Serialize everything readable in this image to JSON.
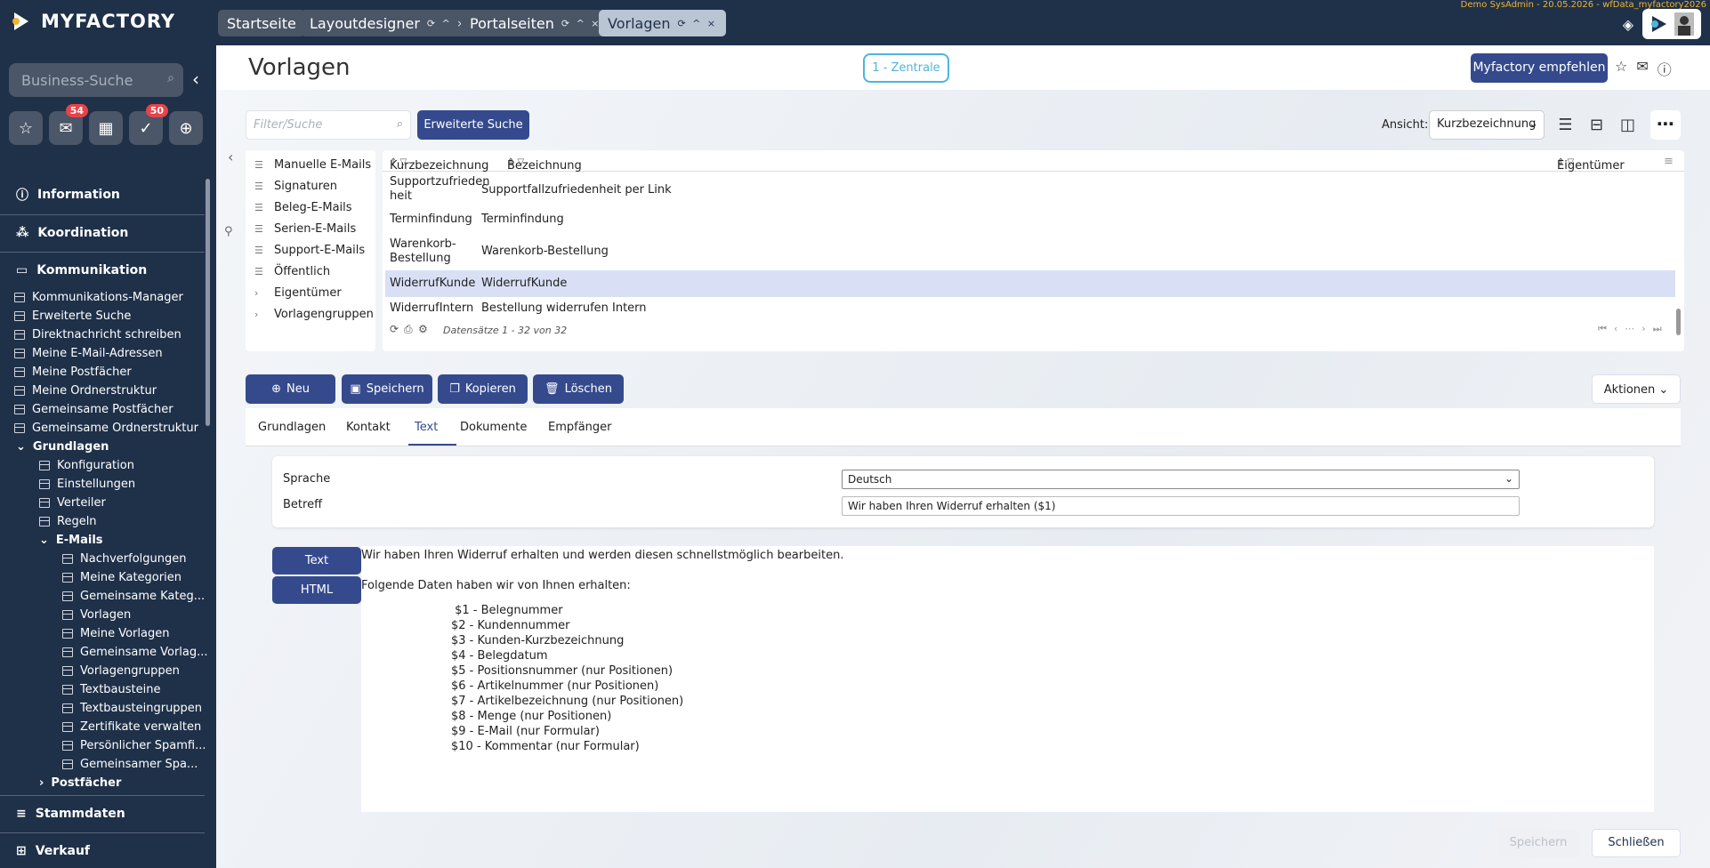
{
  "app": {
    "brand": "MYFACTORY",
    "user_info": "Demo SysAdmin - 20.05.2026 - wfData_myfactory2026"
  },
  "tabs": [
    {
      "label": "Startseite",
      "controls": ""
    },
    {
      "label": "Layoutdesigner",
      "controls": "⟳ ^ ×"
    },
    {
      "label": "Portalseiten",
      "controls": "⟳ ^ ×"
    },
    {
      "label": "Vorlagen",
      "controls": "⟳ ^ ×"
    }
  ],
  "sidebar": {
    "search_placeholder": "Business-Suche",
    "badges": {
      "mail": "54",
      "tasks": "50"
    },
    "sections": {
      "information": "Information",
      "koordination": "Koordination",
      "kommunikation": "Kommunikation",
      "stammdaten": "Stammdaten",
      "verkauf": "Verkauf"
    },
    "comm_items": [
      "Kommunikations-Manager",
      "Erweiterte Suche",
      "Direktnachricht schreiben",
      "Meine E-Mail-Adressen",
      "Meine Postfächer",
      "Meine Ordnerstruktur",
      "Gemeinsame Postfächer",
      "Gemeinsame Ordnerstruktur"
    ],
    "grundlagen": "Grundlagen",
    "grundlagen_items": [
      "Konfiguration",
      "Einstellungen",
      "Verteiler",
      "Regeln"
    ],
    "emails": "E-Mails",
    "email_items": [
      "Nachverfolgungen",
      "Meine Kategorien",
      "Gemeinsame Kateg...",
      "Vorlagen",
      "Meine Vorlagen",
      "Gemeinsame Vorlag...",
      "Vorlagengruppen",
      "Textbausteine",
      "Textbausteingruppen",
      "Zertifikate verwalten",
      "Persönlicher Spamfi...",
      "Gemeinsamer Spa..."
    ],
    "postfaecher": "Postfächer"
  },
  "header": {
    "title": "Vorlagen",
    "location": "1 - Zentrale",
    "recommend": "Myfactory empfehlen"
  },
  "toolbar": {
    "filter_placeholder": "Filter/Suche",
    "advanced_search": "Erweiterte Suche",
    "view_label": "Ansicht:",
    "view_value": "Kurzbezeichnung"
  },
  "tree": [
    "Manuelle E-Mails",
    "Signaturen",
    "Beleg-E-Mails",
    "Serien-E-Mails",
    "Support-E-Mails",
    "Öffentlich",
    "Eigentümer",
    "Vorlagengruppen"
  ],
  "grid": {
    "columns": {
      "c1": "Kurzbezeichnung",
      "c2": "Bezeichnung",
      "c3": "Eigentümer"
    },
    "rows": [
      {
        "kurz": "Supportzufriedenheit",
        "bez": "Supportfallzufriedenheit per Link"
      },
      {
        "kurz": "Terminfindung",
        "bez": "Terminfindung"
      },
      {
        "kurz": "Warenkorb-Bestellung",
        "bez": "Warenkorb-Bestellung"
      },
      {
        "kurz": "WiderrufKunde",
        "bez": "WiderrufKunde"
      },
      {
        "kurz": "WiderrufIntern",
        "bez": "Bestellung widerrufen Intern"
      }
    ],
    "footer": "Datensätze 1 - 32 von 32"
  },
  "actions": {
    "new": "Neu",
    "save": "Speichern",
    "copy": "Kopieren",
    "delete": "Löschen",
    "aktionen": "Aktionen"
  },
  "detail_tabs": [
    "Grundlagen",
    "Kontakt",
    "Text",
    "Dokumente",
    "Empfänger"
  ],
  "form": {
    "sprache_label": "Sprache",
    "sprache_value": "Deutsch",
    "betreff_label": "Betreff",
    "betreff_value": "Wir haben Ihren Widerruf erhalten ($1)"
  },
  "editor": {
    "mode_text": "Text",
    "mode_html": "HTML",
    "line1": "Wir haben Ihren Widerruf erhalten und werden diesen schnellstmöglich bearbeiten.",
    "line2": "Folgende Daten haben wir von Ihnen erhalten:",
    "fields": [
      " $1 - Belegnummer",
      "$2 - Kundennummer",
      "$3 - Kunden-Kurzbezeichnung",
      "$4 - Belegdatum",
      "$5 - Positionsnummer (nur Positionen)",
      "$6 - Artikelnummer (nur Positionen)",
      "$7 - Artikelbezeichnung (nur Positionen)",
      "$8 - Menge (nur Positionen)",
      "$9 - E-Mail (nur Formular)",
      "$10 - Kommentar (nur Formular)"
    ]
  },
  "footer": {
    "save": "Speichern",
    "close": "Schließen"
  }
}
